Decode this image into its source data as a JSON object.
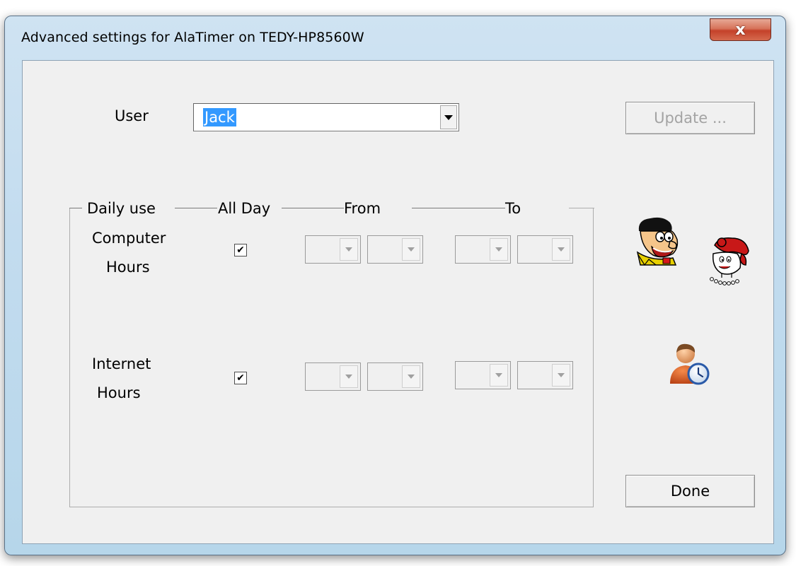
{
  "window": {
    "title": "Advanced settings for AlaTimer on TEDY-HP8560W",
    "close_glyph": "x"
  },
  "user": {
    "label": "User",
    "selected": "Jack"
  },
  "buttons": {
    "update": "Update ...",
    "done": "Done"
  },
  "group": {
    "header_daily": "Daily use",
    "header_allday": "All Day",
    "header_from": "From",
    "header_to": "To"
  },
  "rows": [
    {
      "label_line1": "Computer",
      "label_line2": "Hours",
      "all_day": true,
      "check_glyph": "✔"
    },
    {
      "label_line1": "Internet",
      "label_line2": "Hours",
      "all_day": true,
      "check_glyph": "✔"
    }
  ],
  "icons": {
    "fred": "fred-flintstone-icon",
    "wilma": "wilma-flintstone-icon",
    "user_clock": "user-clock-icon"
  },
  "colors": {
    "selection": "#3399ff",
    "close_button": "#c4412a",
    "client_bg": "#f0f0f0"
  }
}
